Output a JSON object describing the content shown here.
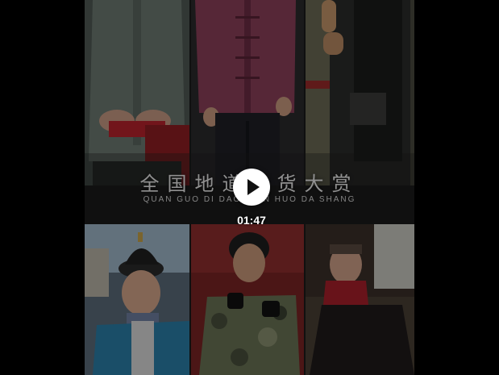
{
  "video": {
    "title_cn": "全国地道年货大赏",
    "title_pinyin": "QUAN GUO DI DAO NIAN HUO DA SHANG",
    "duration": "01:47"
  },
  "controls": {
    "play_icon": "play-icon"
  },
  "colors": {
    "background": "#000000",
    "play_button": "#ffffff",
    "text": "#ffffff"
  }
}
